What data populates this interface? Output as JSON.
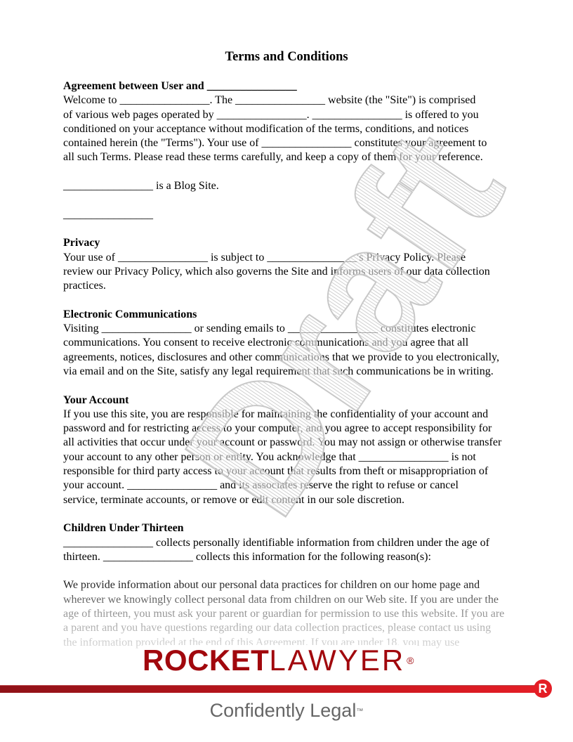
{
  "document": {
    "title": "Terms and Conditions",
    "sections": [
      {
        "heading": "Agreement between User and ________________",
        "lines": [
          "Welcome to ________________. The ________________ website (the \"Site\") is comprised",
          "of various web pages operated by ________________. ________________ is offered to you",
          "conditioned on your acceptance without modification of the terms, conditions, and notices",
          "contained herein (the \"Terms\"). Your use of ________________ constitutes your agreement to",
          "all such Terms. Please read these terms carefully, and keep a copy of them for your reference."
        ]
      },
      {
        "heading": "",
        "lines": [
          "________________ is a Blog Site."
        ]
      },
      {
        "heading": "",
        "lines": [
          "________________"
        ]
      },
      {
        "heading": "Privacy",
        "lines": [
          "Your use of ________________ is subject to ________________'s Privacy Policy. Please",
          "review our Privacy Policy, which also governs the Site and informs users of our data collection",
          "practices."
        ]
      },
      {
        "heading": "Electronic Communications",
        "lines": [
          "Visiting ________________ or sending emails to ________________ constitutes electronic",
          "communications. You consent to receive electronic communications and you agree that all",
          "agreements, notices, disclosures and other communications that we provide to you electronically,",
          "via email and on the Site, satisfy any legal requirement that such communications be in writing."
        ]
      },
      {
        "heading": "Your Account",
        "lines": [
          "If you use this site, you are responsible for maintaining the confidentiality of your account and",
          "password and for restricting access to your computer, and you agree to accept responsibility for",
          "all activities that occur under your account or password. You may not assign or otherwise transfer",
          "your account to any other person or entity. You acknowledge that ________________ is not",
          "responsible for third party access to your account that results from theft or misappropriation of",
          "your account. ________________ and its associates reserve the right to refuse or cancel",
          "service, terminate accounts, or remove or edit content in our sole discretion."
        ]
      },
      {
        "heading": "Children Under Thirteen",
        "lines": [
          "________________ collects personally identifiable information from children under the age of",
          "thirteen. ________________ collects this information for the following reason(s):"
        ]
      },
      {
        "heading": "",
        "lines": [
          "We provide information about our personal data practices for children on our home page and",
          "wherever we knowingly collect personal data from children on our Web site. If you are under the",
          "age of thirteen, you must ask your parent or guardian for permission to use this website. If you are",
          "a parent and you have questions regarding our data collection practices, please contact us using",
          "the information provided at the end of this Agreement. If you are under 18, you may use"
        ]
      }
    ]
  },
  "watermark": {
    "text": "Draft"
  },
  "branding": {
    "logo_bold": "ROCKET",
    "logo_thin": "LAWYER",
    "logo_mark": "®",
    "badge_letter": "R",
    "tagline": "Confidently Legal",
    "tagline_mark": "™",
    "colors": {
      "brand_red": "#a1080d",
      "bar_start": "#8f1218",
      "bar_end": "#e41e26",
      "tagline_gray": "#666666"
    }
  }
}
